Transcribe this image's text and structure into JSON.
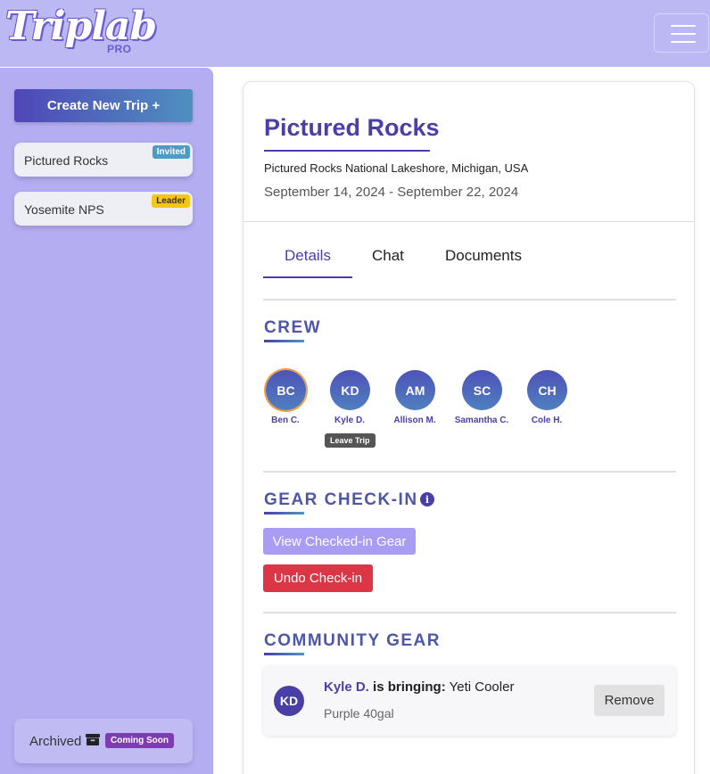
{
  "header": {
    "logo_text": "Triplab",
    "logo_sub": "PRO",
    "menu_icon": "hamburger-menu-icon"
  },
  "sidebar": {
    "create_label": "Create New Trip +",
    "trips": [
      {
        "label": "Pictured Rocks",
        "badge": "Invited"
      },
      {
        "label": "Yosemite NPS",
        "badge": "Leader"
      }
    ],
    "archived_label": "Archived",
    "archived_icon": "archive-box-icon",
    "coming_soon": "Coming Soon"
  },
  "trip": {
    "title": "Pictured Rocks",
    "location": "Pictured Rocks National Lakeshore, Michigan, USA",
    "dates": "September 14, 2024 - September 22, 2024"
  },
  "tabs": [
    {
      "label": "Details",
      "active": true
    },
    {
      "label": "Chat",
      "active": false
    },
    {
      "label": "Documents",
      "active": false
    }
  ],
  "crew": {
    "title": "CREW",
    "members": [
      {
        "initials": "BC",
        "name": "Ben C."
      },
      {
        "initials": "KD",
        "name": "Kyle D."
      },
      {
        "initials": "AM",
        "name": "Allison M."
      },
      {
        "initials": "SC",
        "name": "Samantha C."
      },
      {
        "initials": "CH",
        "name": "Cole H."
      }
    ],
    "tooltip": "Leave Trip"
  },
  "gear_checkin": {
    "title": "GEAR CHECK-IN",
    "info_icon": "info-icon",
    "view_label": "View Checked-in Gear",
    "undo_label": "Undo Check-in"
  },
  "community_gear": {
    "title": "COMMUNITY GEAR",
    "items": [
      {
        "initials": "KD",
        "who": "Kyle D.",
        "bringing": "is bringing:",
        "item": "Yeti Cooler",
        "desc": "Purple 40gal",
        "remove_label": "Remove"
      }
    ]
  },
  "colors": {
    "header_bg": "#bcb8f4",
    "sidebar_bg": "#b4adf2",
    "accent": "#4a3fa6",
    "danger": "#dc3545",
    "invited_badge": "#4d9cc8",
    "leader_badge": "#f5c518",
    "coming_soon_badge": "#7e3cb2"
  }
}
